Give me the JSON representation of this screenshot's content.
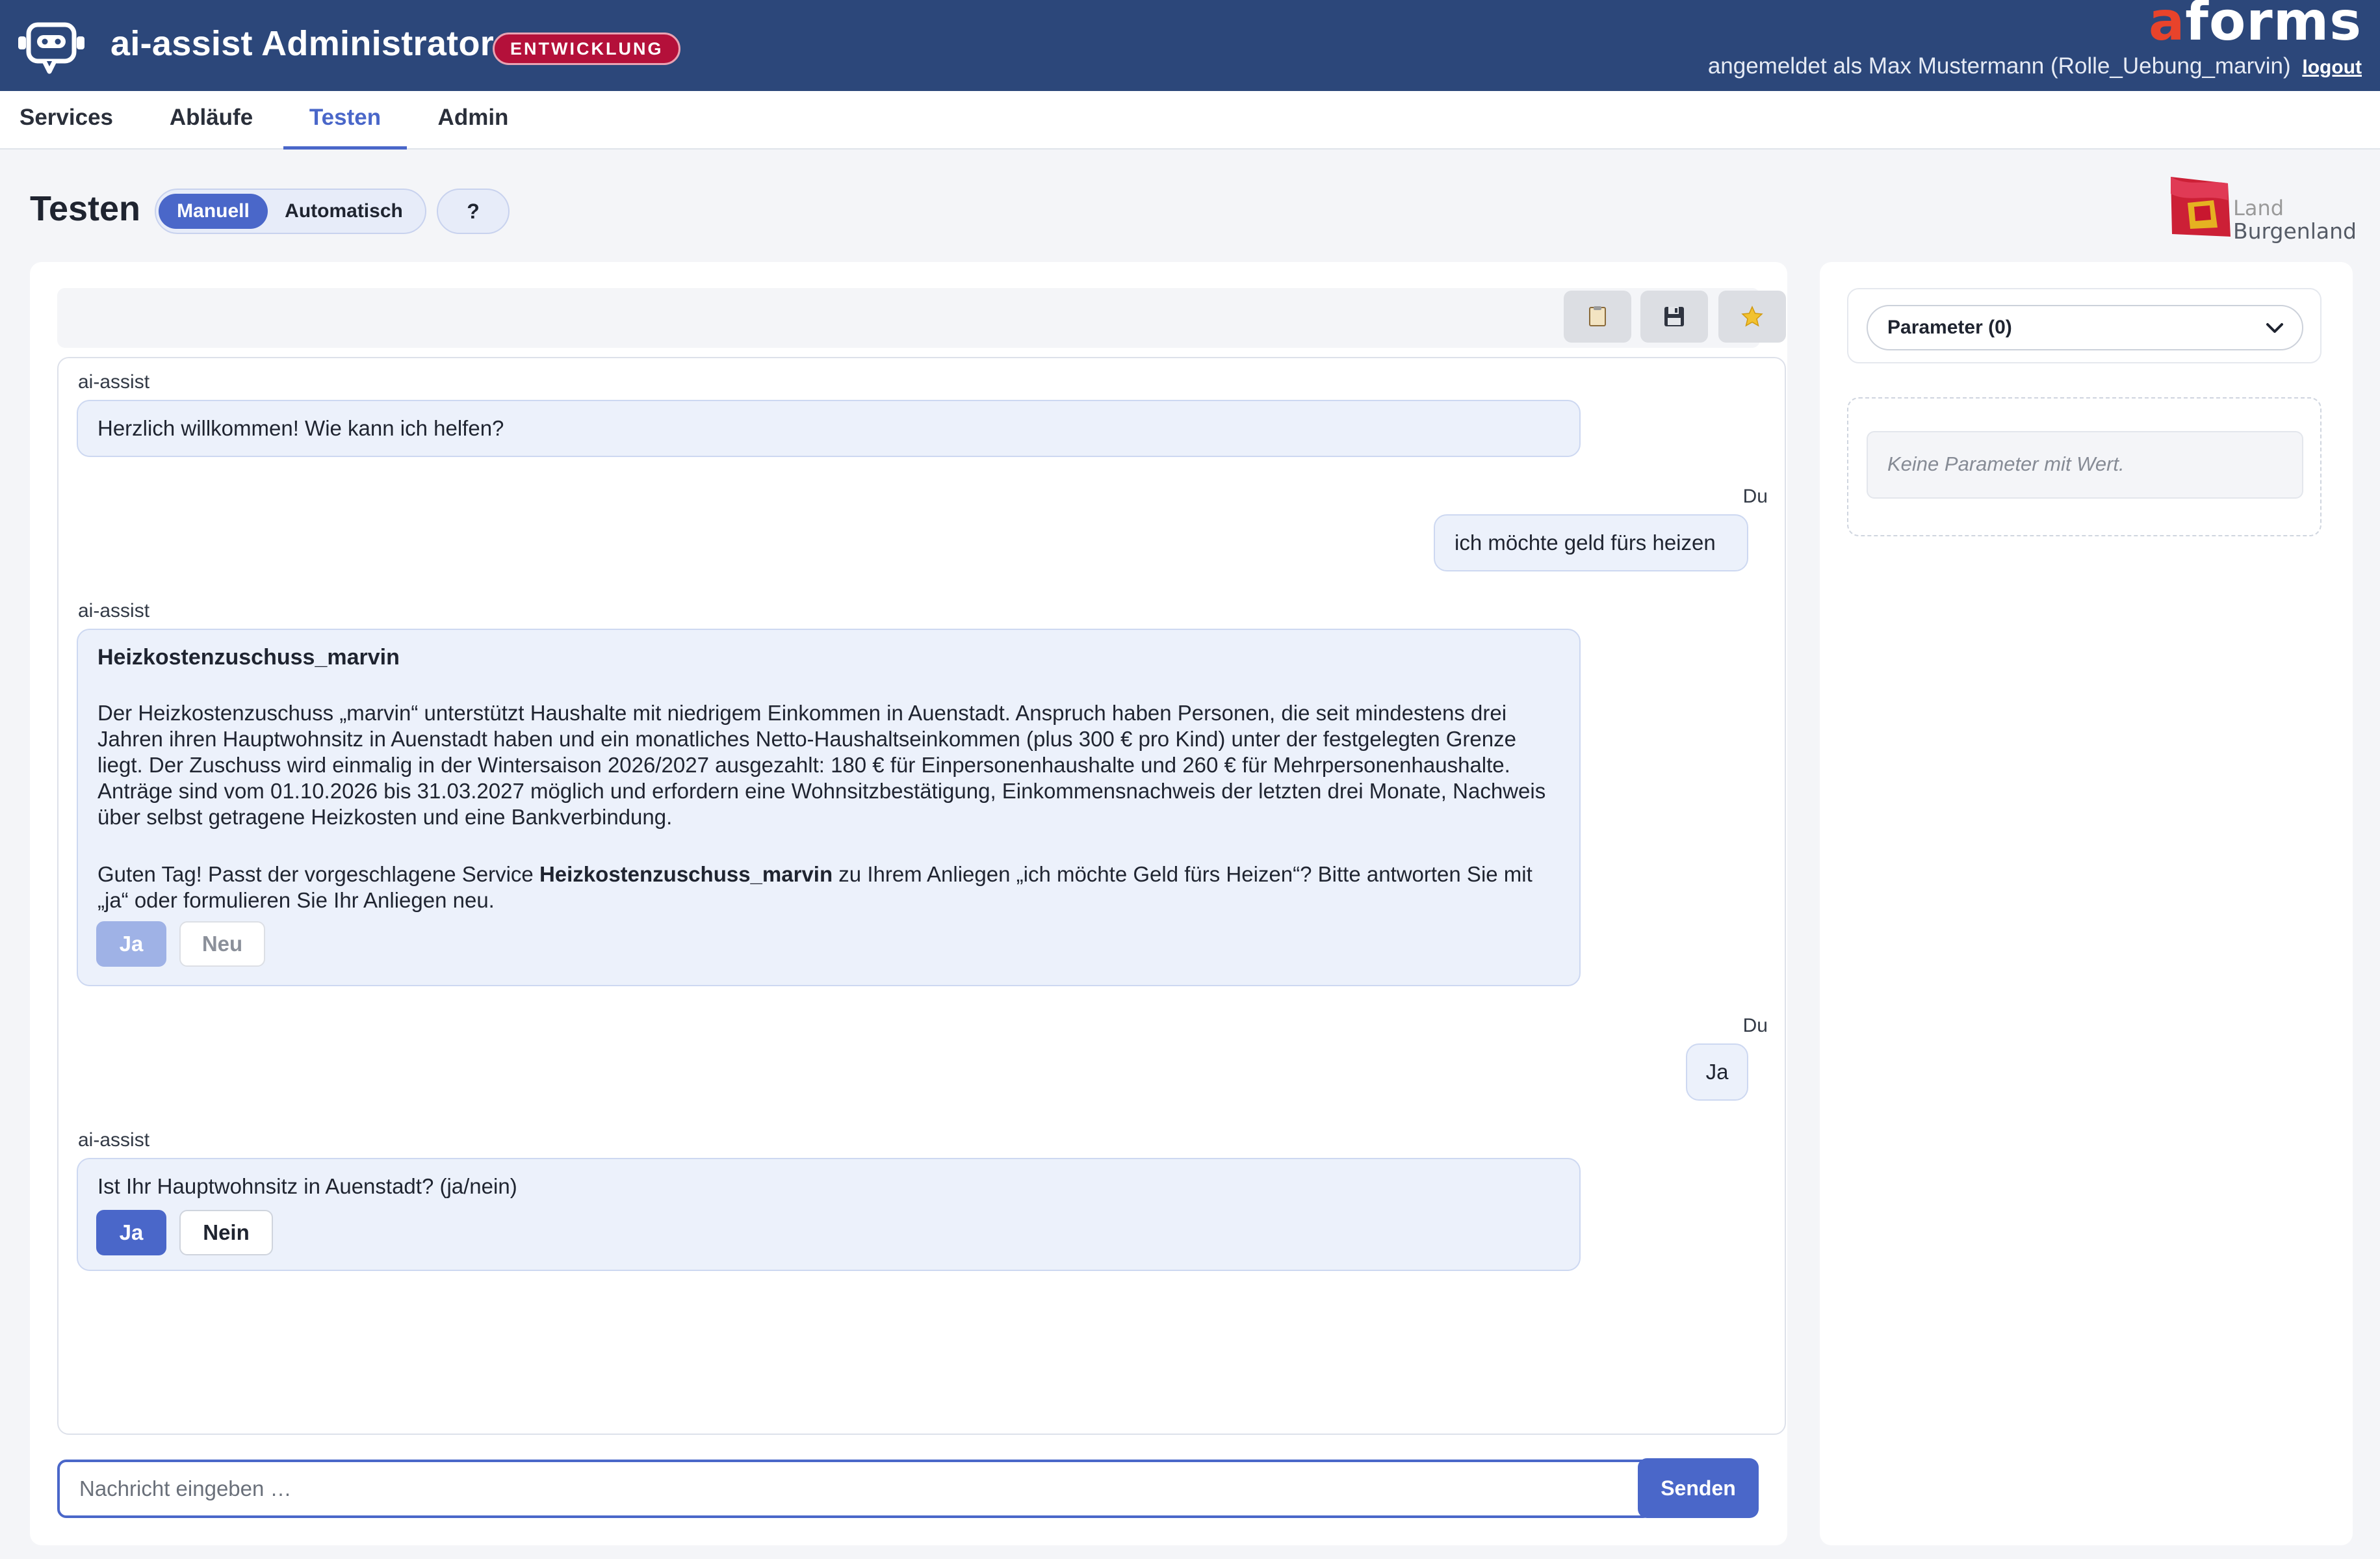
{
  "header": {
    "app_title": "ai-assist Administrator",
    "env_badge": "ENTWICKLUNG",
    "brand_prefix": "a",
    "brand_rest": "forms",
    "user_text": "angemeldet als Max Mustermann (Rolle_Uebung_marvin)",
    "logout_label": "logout",
    "colors": {
      "header_bg": "#2c477a",
      "badge_bg": "#b4103a",
      "brand_accent": "#e8432b"
    }
  },
  "nav": {
    "tabs": [
      {
        "label": "Services",
        "active": false
      },
      {
        "label": "Abläufe",
        "active": false
      },
      {
        "label": "Testen",
        "active": true
      },
      {
        "label": "Admin",
        "active": false
      }
    ]
  },
  "page": {
    "title": "Testen",
    "modes": [
      {
        "label": "Manuell",
        "active": true
      },
      {
        "label": "Automatisch",
        "active": false
      }
    ],
    "help_label": "?",
    "org_logo": {
      "line1": "Land",
      "line2": "Burgenland"
    }
  },
  "toolbar": {
    "icons": [
      "clipboard-icon",
      "save-icon",
      "star-icon"
    ]
  },
  "chat": {
    "messages": [
      {
        "sender": "ai-assist",
        "text": "Herzlich willkommen! Wie kann ich helfen?"
      },
      {
        "sender": "Du",
        "text": "ich möchte geld fürs heizen"
      },
      {
        "sender": "ai-assist",
        "title": "Heizkostenzuschuss_marvin",
        "body": "Der Heizkostenzuschuss „marvin“ unterstützt Haushalte mit niedrigem Einkommen in Auenstadt. Anspruch haben Personen, die seit mindestens drei Jahren ihren Hauptwohnsitz in Auenstadt haben und ein monatliches Netto-Haushaltseinkommen (plus 300 € pro Kind) unter der festgelegten Grenze liegt. Der Zuschuss wird einmalig in der Wintersaison 2026/2027 ausgezahlt: 180 € für Einpersonenhaushalte und 260 € für Mehrpersonenhaushalte. Anträge sind vom 01.10.2026 bis 31.03.2027 möglich und erfordern eine Wohnsitzbestätigung, Einkommensnachweis der letzten drei Monate, Nachweis über selbst getragene Heizkosten und eine Bankverbindung.",
        "question_pre": "Guten Tag! Passt der vorgeschlagene Service ",
        "question_service": "Heizkostenzuschuss_marvin",
        "question_post": " zu Ihrem Anliegen „ich möchte Geld fürs Heizen“? Bitte antworten Sie mit „ja“ oder formulieren Sie Ihr Anliegen neu.",
        "buttons": [
          "Ja",
          "Neu"
        ]
      },
      {
        "sender": "Du",
        "text": "Ja"
      },
      {
        "sender": "ai-assist",
        "text": "Ist Ihr Hauptwohnsitz in Auenstadt? (ja/nein)",
        "buttons": [
          "Ja",
          "Nein"
        ]
      }
    ],
    "input_placeholder": "Nachricht eingeben …",
    "send_label": "Senden",
    "accent_color": "#4a67c9"
  },
  "params": {
    "dropdown_label": "Parameter (0)",
    "empty_text": "Keine Parameter mit Wert."
  }
}
